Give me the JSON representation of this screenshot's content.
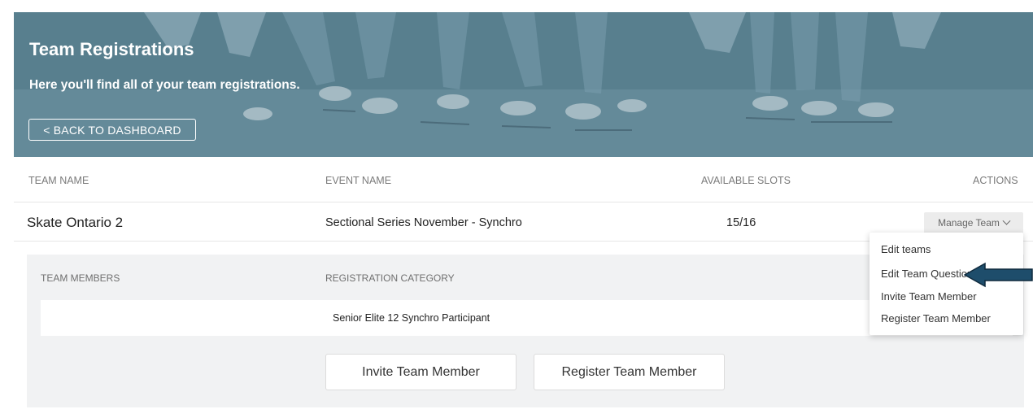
{
  "banner": {
    "title": "Team Registrations",
    "subtitle": "Here you'll find all of your team registrations.",
    "back_button": "< BACK TO DASHBOARD"
  },
  "table": {
    "headers": {
      "team_name": "TEAM NAME",
      "event_name": "EVENT NAME",
      "available_slots": "AVAILABLE SLOTS",
      "actions": "ACTIONS"
    },
    "row": {
      "team_name": "Skate Ontario 2",
      "event_name": "Sectional Series November - Synchro",
      "slots": "15/16",
      "manage_button": "Manage Team"
    }
  },
  "panel": {
    "headers": {
      "team_members": "TEAM MEMBERS",
      "registration_category": "REGISTRATION CATEGORY"
    },
    "member_row": {
      "category": "Senior Elite 12 Synchro Participant"
    },
    "invite_button": "Invite Team Member",
    "register_button": "Register Team Member"
  },
  "dropdown": {
    "items": [
      "Edit teams",
      "Edit Team Questions",
      "Invite Team Member",
      "Register Team Member"
    ]
  },
  "colors": {
    "banner": "#5f8797",
    "arrow_fill": "#1e4d6b",
    "panel_bg": "#f1f2f3"
  }
}
